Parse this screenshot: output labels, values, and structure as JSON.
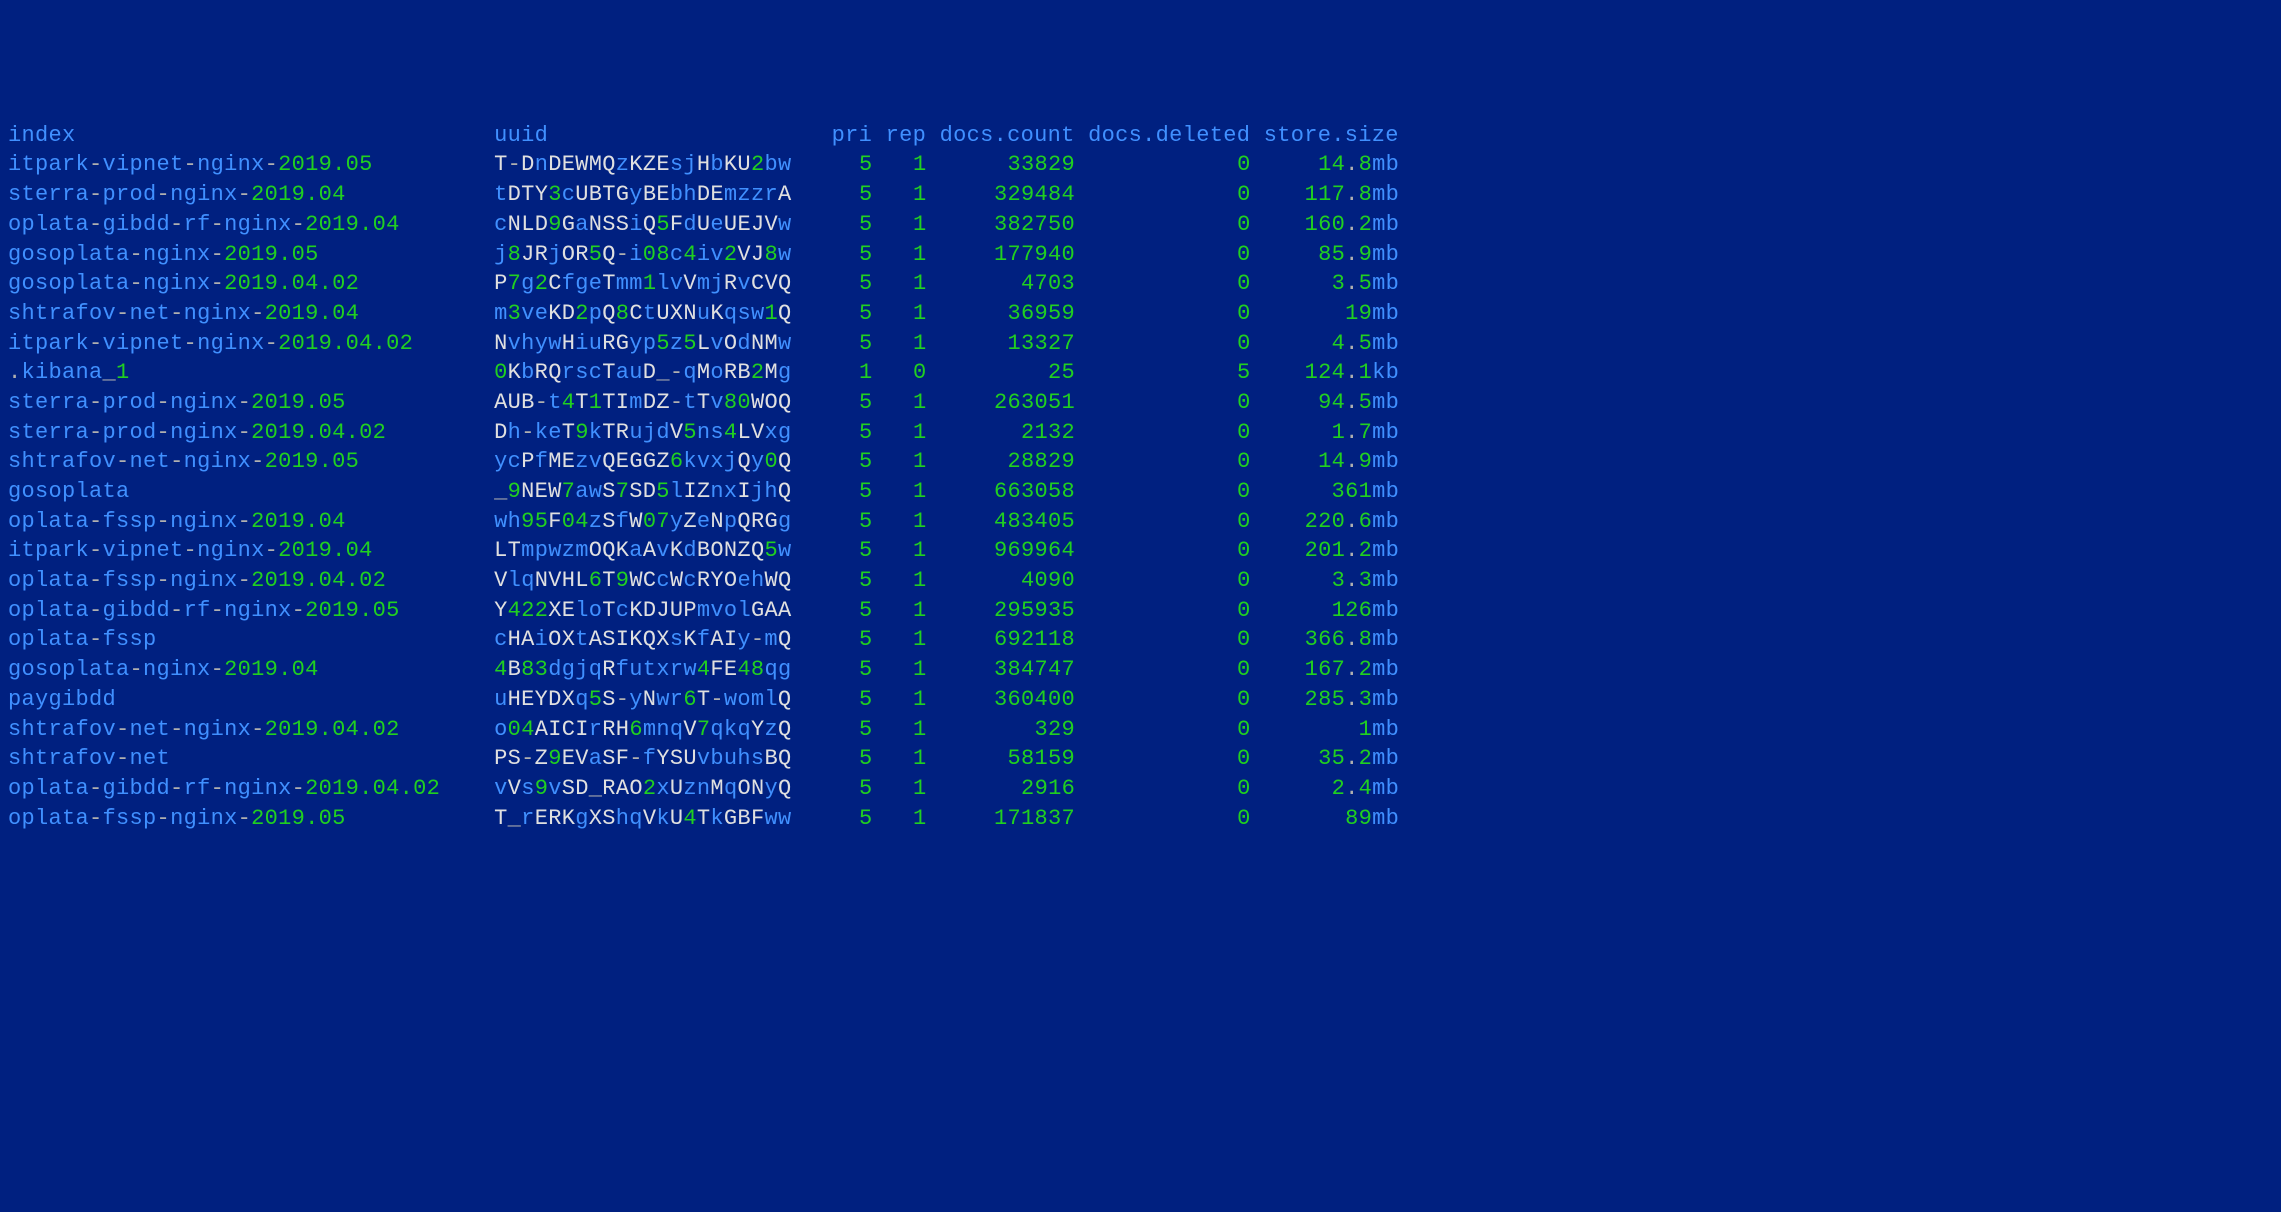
{
  "header": {
    "index": "index",
    "uuid": "uuid",
    "pri": "pri",
    "rep": "rep",
    "docs_count": "docs.count",
    "docs_deleted": "docs.deleted",
    "store_size": "store.size"
  },
  "rows": [
    {
      "index_parts": [
        [
          "itpark",
          "n"
        ],
        [
          "-",
          "p"
        ],
        [
          "vipnet",
          "n"
        ],
        [
          "-",
          "p"
        ],
        [
          "nginx",
          "n"
        ],
        [
          "-",
          "p"
        ],
        [
          "2019.05",
          "d"
        ]
      ],
      "uuid": "T-DnDEWMQzKZEsjHbKU2bw",
      "pri": "5",
      "rep": "1",
      "docs_count": "33829",
      "docs_deleted": "0",
      "store_num": "14.8",
      "store_unit": "mb"
    },
    {
      "index_parts": [
        [
          "sterra",
          "n"
        ],
        [
          "-",
          "p"
        ],
        [
          "prod",
          "n"
        ],
        [
          "-",
          "p"
        ],
        [
          "nginx",
          "n"
        ],
        [
          "-",
          "p"
        ],
        [
          "2019.04",
          "d"
        ]
      ],
      "uuid": "tDTY3cUBTGyBEbhDEmzzrA",
      "pri": "5",
      "rep": "1",
      "docs_count": "329484",
      "docs_deleted": "0",
      "store_num": "117.8",
      "store_unit": "mb"
    },
    {
      "index_parts": [
        [
          "oplata",
          "n"
        ],
        [
          "-",
          "p"
        ],
        [
          "gibdd",
          "n"
        ],
        [
          "-",
          "p"
        ],
        [
          "rf",
          "n"
        ],
        [
          "-",
          "p"
        ],
        [
          "nginx",
          "n"
        ],
        [
          "-",
          "p"
        ],
        [
          "2019.04",
          "d"
        ]
      ],
      "uuid": "cNLD9GaNSSiQ5FdUeUEJVw",
      "pri": "5",
      "rep": "1",
      "docs_count": "382750",
      "docs_deleted": "0",
      "store_num": "160.2",
      "store_unit": "mb"
    },
    {
      "index_parts": [
        [
          "gosoplata",
          "n"
        ],
        [
          "-",
          "p"
        ],
        [
          "nginx",
          "n"
        ],
        [
          "-",
          "p"
        ],
        [
          "2019.05",
          "d"
        ]
      ],
      "uuid": "j8JRjOR5Q-i08c4iv2VJ8w",
      "pri": "5",
      "rep": "1",
      "docs_count": "177940",
      "docs_deleted": "0",
      "store_num": "85.9",
      "store_unit": "mb"
    },
    {
      "index_parts": [
        [
          "gosoplata",
          "n"
        ],
        [
          "-",
          "p"
        ],
        [
          "nginx",
          "n"
        ],
        [
          "-",
          "p"
        ],
        [
          "2019.04.02",
          "d"
        ]
      ],
      "uuid": "P7g2CfgeTmm1lvVmjRvCVQ",
      "pri": "5",
      "rep": "1",
      "docs_count": "4703",
      "docs_deleted": "0",
      "store_num": "3.5",
      "store_unit": "mb"
    },
    {
      "index_parts": [
        [
          "shtrafov",
          "n"
        ],
        [
          "-",
          "p"
        ],
        [
          "net",
          "n"
        ],
        [
          "-",
          "p"
        ],
        [
          "nginx",
          "n"
        ],
        [
          "-",
          "p"
        ],
        [
          "2019.04",
          "d"
        ]
      ],
      "uuid": "m3veKD2pQ8CtUXNuKqsw1Q",
      "pri": "5",
      "rep": "1",
      "docs_count": "36959",
      "docs_deleted": "0",
      "store_num": "19",
      "store_unit": "mb"
    },
    {
      "index_parts": [
        [
          "itpark",
          "n"
        ],
        [
          "-",
          "p"
        ],
        [
          "vipnet",
          "n"
        ],
        [
          "-",
          "p"
        ],
        [
          "nginx",
          "n"
        ],
        [
          "-",
          "p"
        ],
        [
          "2019.04.02",
          "d"
        ]
      ],
      "uuid": "NvhywHiuRGyp5z5LvOdNMw",
      "pri": "5",
      "rep": "1",
      "docs_count": "13327",
      "docs_deleted": "0",
      "store_num": "4.5",
      "store_unit": "mb"
    },
    {
      "index_parts": [
        [
          ".",
          "p"
        ],
        [
          "kibana",
          "n"
        ],
        [
          "_",
          "p"
        ],
        [
          "1",
          "d"
        ]
      ],
      "uuid": "0KbRQrscTauD_-qMoRB2Mg",
      "pri": "1",
      "rep": "0",
      "docs_count": "25",
      "docs_deleted": "5",
      "store_num": "124.1",
      "store_unit": "kb"
    },
    {
      "index_parts": [
        [
          "sterra",
          "n"
        ],
        [
          "-",
          "p"
        ],
        [
          "prod",
          "n"
        ],
        [
          "-",
          "p"
        ],
        [
          "nginx",
          "n"
        ],
        [
          "-",
          "p"
        ],
        [
          "2019.05",
          "d"
        ]
      ],
      "uuid": "AUB-t4T1TImDZ-tTv80WOQ",
      "pri": "5",
      "rep": "1",
      "docs_count": "263051",
      "docs_deleted": "0",
      "store_num": "94.5",
      "store_unit": "mb"
    },
    {
      "index_parts": [
        [
          "sterra",
          "n"
        ],
        [
          "-",
          "p"
        ],
        [
          "prod",
          "n"
        ],
        [
          "-",
          "p"
        ],
        [
          "nginx",
          "n"
        ],
        [
          "-",
          "p"
        ],
        [
          "2019.04.02",
          "d"
        ]
      ],
      "uuid": "Dh-keT9kTRujdV5ns4LVxg",
      "pri": "5",
      "rep": "1",
      "docs_count": "2132",
      "docs_deleted": "0",
      "store_num": "1.7",
      "store_unit": "mb"
    },
    {
      "index_parts": [
        [
          "shtrafov",
          "n"
        ],
        [
          "-",
          "p"
        ],
        [
          "net",
          "n"
        ],
        [
          "-",
          "p"
        ],
        [
          "nginx",
          "n"
        ],
        [
          "-",
          "p"
        ],
        [
          "2019.05",
          "d"
        ]
      ],
      "uuid": "ycPfMEzvQEGGZ6kvxjQy0Q",
      "pri": "5",
      "rep": "1",
      "docs_count": "28829",
      "docs_deleted": "0",
      "store_num": "14.9",
      "store_unit": "mb"
    },
    {
      "index_parts": [
        [
          "gosoplata",
          "n"
        ]
      ],
      "uuid": "_9NEW7awS7SD5lIZnxIjhQ",
      "pri": "5",
      "rep": "1",
      "docs_count": "663058",
      "docs_deleted": "0",
      "store_num": "361",
      "store_unit": "mb"
    },
    {
      "index_parts": [
        [
          "oplata",
          "n"
        ],
        [
          "-",
          "p"
        ],
        [
          "fssp",
          "n"
        ],
        [
          "-",
          "p"
        ],
        [
          "nginx",
          "n"
        ],
        [
          "-",
          "p"
        ],
        [
          "2019.04",
          "d"
        ]
      ],
      "uuid": "wh95F04zSfW07yZeNpQRGg",
      "pri": "5",
      "rep": "1",
      "docs_count": "483405",
      "docs_deleted": "0",
      "store_num": "220.6",
      "store_unit": "mb"
    },
    {
      "index_parts": [
        [
          "itpark",
          "n"
        ],
        [
          "-",
          "p"
        ],
        [
          "vipnet",
          "n"
        ],
        [
          "-",
          "p"
        ],
        [
          "nginx",
          "n"
        ],
        [
          "-",
          "p"
        ],
        [
          "2019.04",
          "d"
        ]
      ],
      "uuid": "LTmpwzmOQKaAvKdBONZQ5w",
      "pri": "5",
      "rep": "1",
      "docs_count": "969964",
      "docs_deleted": "0",
      "store_num": "201.2",
      "store_unit": "mb"
    },
    {
      "index_parts": [
        [
          "oplata",
          "n"
        ],
        [
          "-",
          "p"
        ],
        [
          "fssp",
          "n"
        ],
        [
          "-",
          "p"
        ],
        [
          "nginx",
          "n"
        ],
        [
          "-",
          "p"
        ],
        [
          "2019.04.02",
          "d"
        ]
      ],
      "uuid": "VlqNVHL6T9WCcWcRYOehWQ",
      "pri": "5",
      "rep": "1",
      "docs_count": "4090",
      "docs_deleted": "0",
      "store_num": "3.3",
      "store_unit": "mb"
    },
    {
      "index_parts": [
        [
          "oplata",
          "n"
        ],
        [
          "-",
          "p"
        ],
        [
          "gibdd",
          "n"
        ],
        [
          "-",
          "p"
        ],
        [
          "rf",
          "n"
        ],
        [
          "-",
          "p"
        ],
        [
          "nginx",
          "n"
        ],
        [
          "-",
          "p"
        ],
        [
          "2019.05",
          "d"
        ]
      ],
      "uuid": "Y422XEloTcKDJUPmvolGAA",
      "pri": "5",
      "rep": "1",
      "docs_count": "295935",
      "docs_deleted": "0",
      "store_num": "126",
      "store_unit": "mb"
    },
    {
      "index_parts": [
        [
          "oplata",
          "n"
        ],
        [
          "-",
          "p"
        ],
        [
          "fssp",
          "n"
        ]
      ],
      "uuid": "cHAiOXtASIKQXsKfAIy-mQ",
      "pri": "5",
      "rep": "1",
      "docs_count": "692118",
      "docs_deleted": "0",
      "store_num": "366.8",
      "store_unit": "mb"
    },
    {
      "index_parts": [
        [
          "gosoplata",
          "n"
        ],
        [
          "-",
          "p"
        ],
        [
          "nginx",
          "n"
        ],
        [
          "-",
          "p"
        ],
        [
          "2019.04",
          "d"
        ]
      ],
      "uuid": "4B83dgjqRfutxrw4FE48qg",
      "pri": "5",
      "rep": "1",
      "docs_count": "384747",
      "docs_deleted": "0",
      "store_num": "167.2",
      "store_unit": "mb"
    },
    {
      "index_parts": [
        [
          "paygibdd",
          "n"
        ]
      ],
      "uuid": "uHEYDXq5S-yNwr6T-womlQ",
      "pri": "5",
      "rep": "1",
      "docs_count": "360400",
      "docs_deleted": "0",
      "store_num": "285.3",
      "store_unit": "mb"
    },
    {
      "index_parts": [
        [
          "shtrafov",
          "n"
        ],
        [
          "-",
          "p"
        ],
        [
          "net",
          "n"
        ],
        [
          "-",
          "p"
        ],
        [
          "nginx",
          "n"
        ],
        [
          "-",
          "p"
        ],
        [
          "2019.04.02",
          "d"
        ]
      ],
      "uuid": "o04AICIrRH6mnqV7qkqYzQ",
      "pri": "5",
      "rep": "1",
      "docs_count": "329",
      "docs_deleted": "0",
      "store_num": "1",
      "store_unit": "mb"
    },
    {
      "index_parts": [
        [
          "shtrafov",
          "n"
        ],
        [
          "-",
          "p"
        ],
        [
          "net",
          "n"
        ]
      ],
      "uuid": "PS-Z9EVaSF-fYSUvbuhsBQ",
      "pri": "5",
      "rep": "1",
      "docs_count": "58159",
      "docs_deleted": "0",
      "store_num": "35.2",
      "store_unit": "mb"
    },
    {
      "index_parts": [
        [
          "oplata",
          "n"
        ],
        [
          "-",
          "p"
        ],
        [
          "gibdd",
          "n"
        ],
        [
          "-",
          "p"
        ],
        [
          "rf",
          "n"
        ],
        [
          "-",
          "p"
        ],
        [
          "nginx",
          "n"
        ],
        [
          "-",
          "p"
        ],
        [
          "2019.04.02",
          "d"
        ]
      ],
      "uuid": "vVs9vSD_RAO2xUznMqONyQ",
      "pri": "5",
      "rep": "1",
      "docs_count": "2916",
      "docs_deleted": "0",
      "store_num": "2.4",
      "store_unit": "mb"
    },
    {
      "index_parts": [
        [
          "oplata",
          "n"
        ],
        [
          "-",
          "p"
        ],
        [
          "fssp",
          "n"
        ],
        [
          "-",
          "p"
        ],
        [
          "nginx",
          "n"
        ],
        [
          "-",
          "p"
        ],
        [
          "2019.05",
          "d"
        ]
      ],
      "uuid": "T_rERKgXShqVkU4TkGBFww",
      "pri": "5",
      "rep": "1",
      "docs_count": "171837",
      "docs_deleted": "0",
      "store_num": "89",
      "store_unit": "mb"
    }
  ],
  "col_widths": {
    "index": 36,
    "uuid": 22,
    "pri": 6,
    "rep": 4,
    "docs_count": 11,
    "docs_deleted": 13,
    "store_size": 11
  }
}
